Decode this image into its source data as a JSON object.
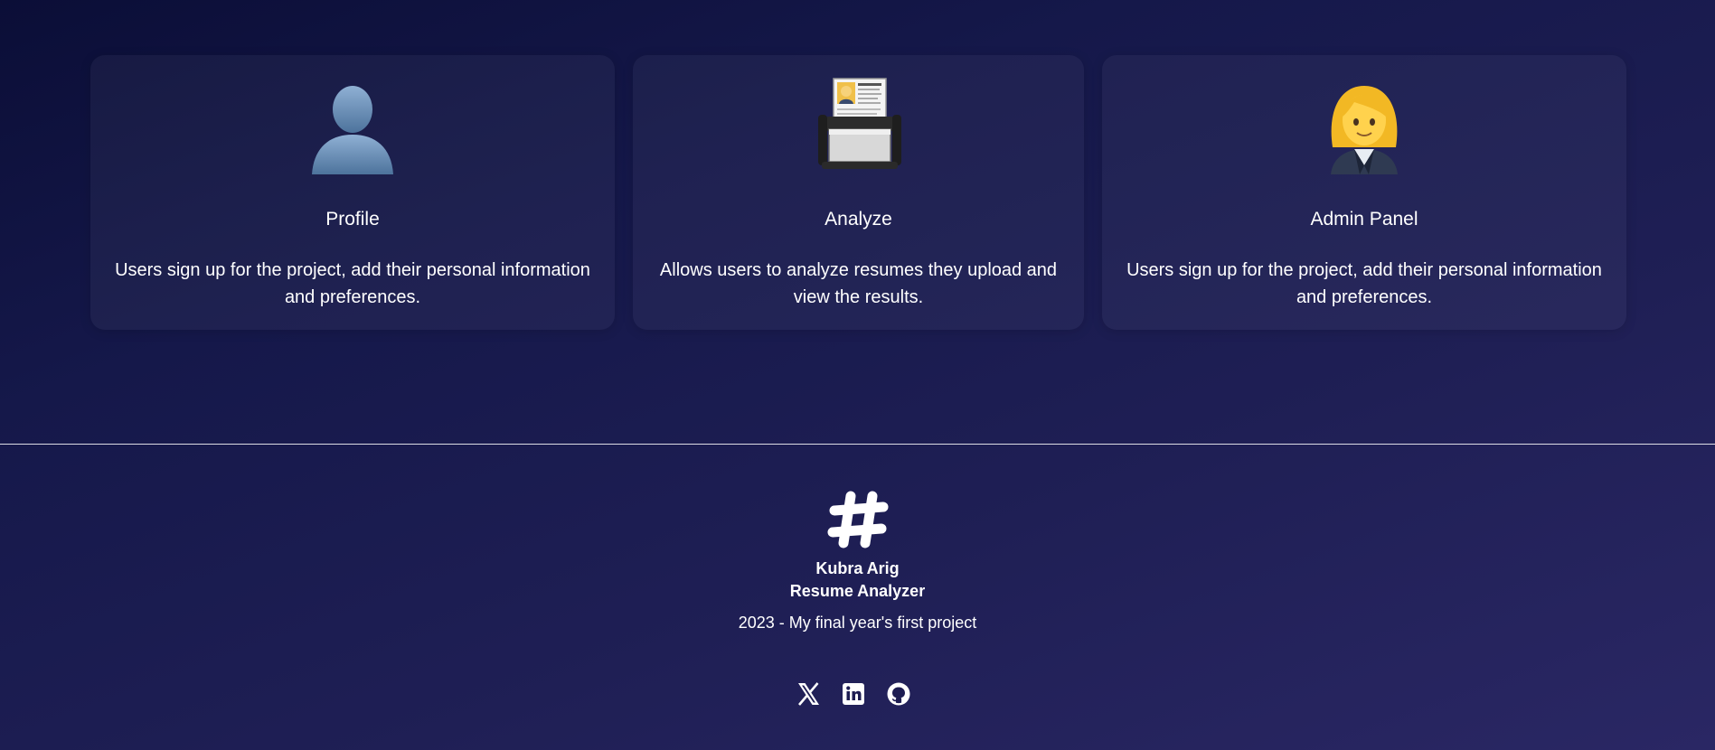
{
  "features": [
    {
      "icon": "bust-in-silhouette-icon",
      "title": "Profile",
      "description": "Users sign up for the project, add their personal information and preferences."
    },
    {
      "icon": "resume-scanner-icon",
      "title": "Analyze",
      "description": "Allows users to analyze resumes they upload and view the results."
    },
    {
      "icon": "woman-office-worker-icon",
      "title": "Admin Panel",
      "description": "Users sign up for the project, add their personal information and preferences."
    }
  ],
  "footer": {
    "logo_icon": "hash-logo-icon",
    "author": "Kubra Arig",
    "product": "Resume Analyzer",
    "tagline": "2023 - My final year's first project",
    "socials": [
      {
        "icon": "x-twitter-icon",
        "label": "X"
      },
      {
        "icon": "linkedin-icon",
        "label": "LinkedIn"
      },
      {
        "icon": "github-icon",
        "label": "GitHub"
      }
    ]
  },
  "colors": {
    "background_start": "#0b0e37",
    "background_end": "#2a2764",
    "text": "#ffffff"
  }
}
